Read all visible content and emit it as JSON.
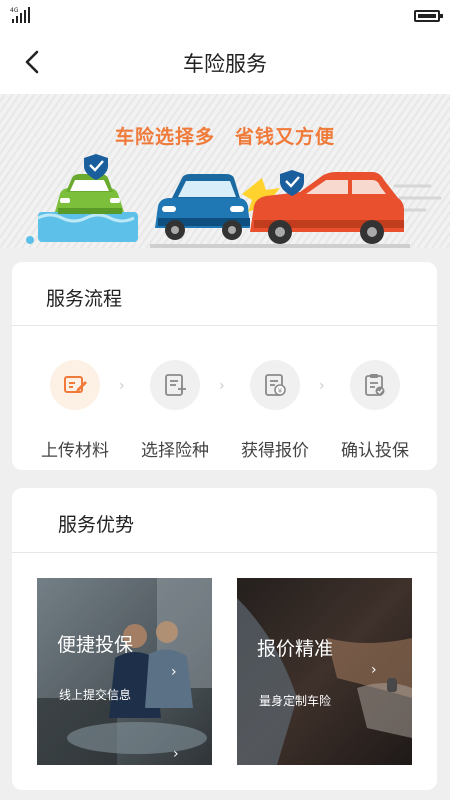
{
  "status_bar": {
    "network": "4G"
  },
  "nav": {
    "title": "车险服务",
    "back_icon": "chevron-left-icon"
  },
  "banner": {
    "slogan_left": "车险选择多",
    "slogan_right": "省钱又方便"
  },
  "process": {
    "title": "服务流程",
    "steps": [
      {
        "label": "上传材料",
        "icon": "edit-document-icon",
        "active": true
      },
      {
        "label": "选择险种",
        "icon": "document-add-icon",
        "active": false
      },
      {
        "label": "获得报价",
        "icon": "document-price-icon",
        "active": false
      },
      {
        "label": "确认投保",
        "icon": "clipboard-check-icon",
        "active": false
      }
    ]
  },
  "advantages": {
    "title": "服务优势",
    "cards": [
      {
        "title": "便捷投保",
        "subtitle": "线上提交信息"
      },
      {
        "title": "报价精准",
        "subtitle": "量身定制车险"
      }
    ]
  },
  "colors": {
    "accent": "#f07a3a",
    "step_active_bg": "#fdf0e4",
    "step_bg": "#f0f0f0",
    "page_bg": "#efefef"
  }
}
